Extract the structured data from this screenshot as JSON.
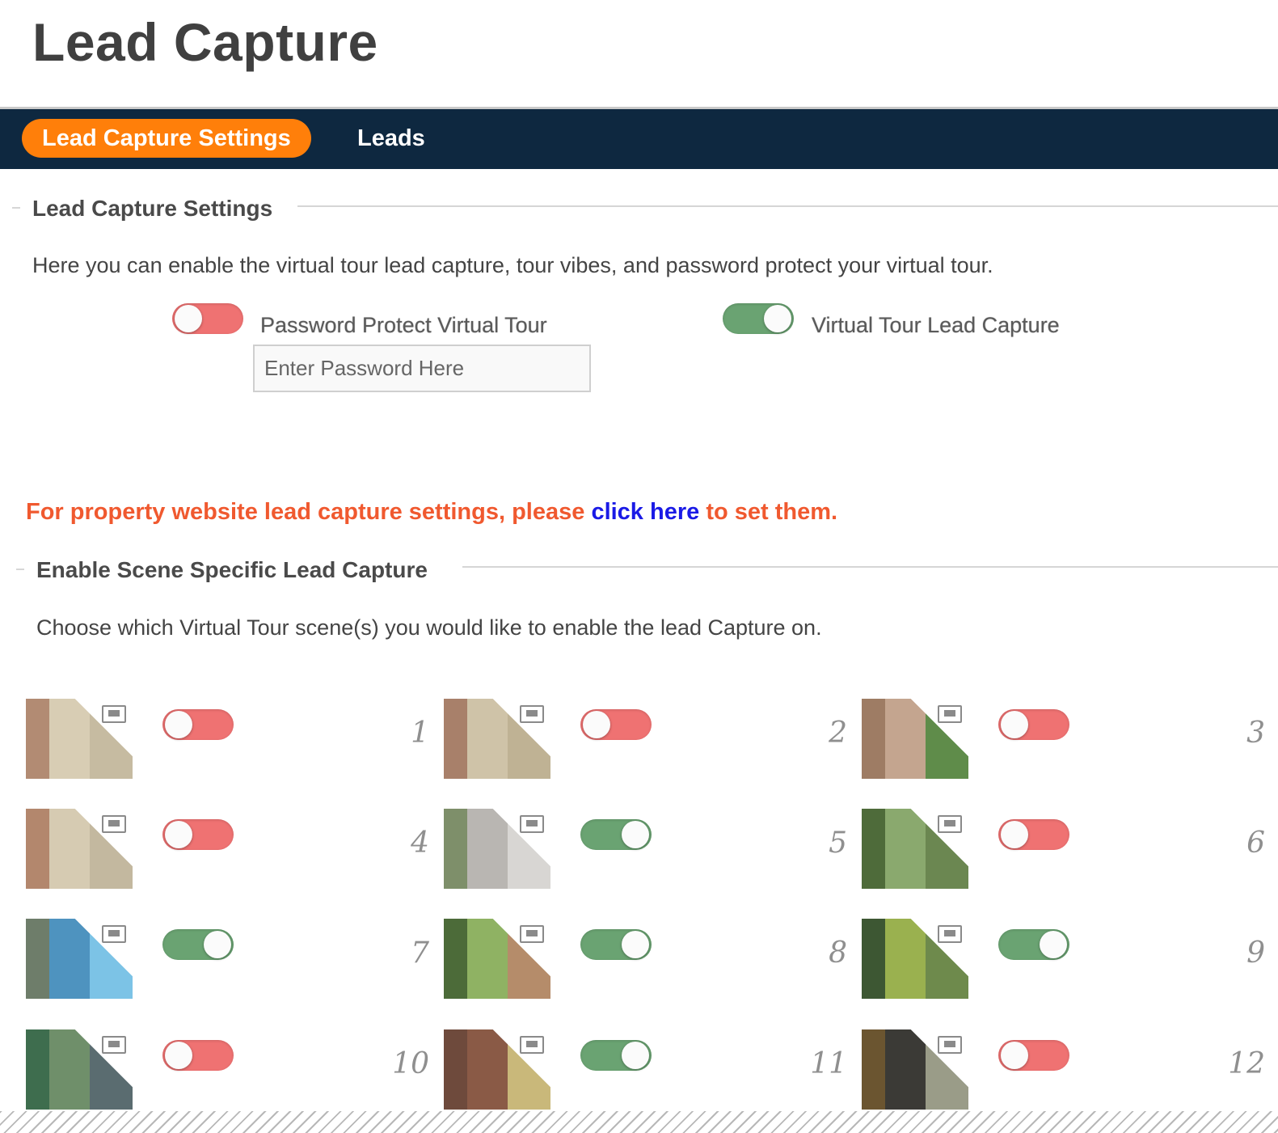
{
  "page": {
    "title": "Lead Capture"
  },
  "nav": {
    "tabs": [
      {
        "label": "Lead Capture Settings",
        "active": true
      },
      {
        "label": "Leads",
        "active": false
      }
    ]
  },
  "settings": {
    "legend": "Lead Capture Settings",
    "description": "Here you can enable the virtual tour lead capture, tour vibes, and password protect your virtual tour.",
    "password_toggle": {
      "label": "Password Protect Virtual Tour",
      "on": false
    },
    "password_input": {
      "placeholder": "Enter Password Here",
      "value": ""
    },
    "lead_capture_toggle": {
      "label": "Virtual Tour Lead Capture",
      "on": true
    }
  },
  "notice": {
    "prefix": "For property website lead capture settings, please ",
    "link": "click here",
    "suffix": " to set them."
  },
  "scenes_section": {
    "legend": "Enable Scene Specific Lead Capture",
    "description": "Choose which Virtual Tour scene(s) you would like to enable the lead Capture on.",
    "icon": "image-icon",
    "scenes": [
      {
        "num": "1",
        "on": false,
        "colors": [
          "#b28b73",
          "#d8cdb4",
          "#c6bba1"
        ]
      },
      {
        "num": "2",
        "on": false,
        "colors": [
          "#a8806a",
          "#cfc3a8",
          "#bfb294"
        ]
      },
      {
        "num": "3",
        "on": false,
        "colors": [
          "#9e7c64",
          "#c4a58f",
          "#5f8c4a"
        ]
      },
      {
        "num": "4",
        "on": false,
        "colors": [
          "#b3876d",
          "#d6cbb2",
          "#c3b89f"
        ]
      },
      {
        "num": "5",
        "on": true,
        "colors": [
          "#7e8f6a",
          "#b9b6b2",
          "#d8d6d3"
        ]
      },
      {
        "num": "6",
        "on": false,
        "colors": [
          "#4e6b3a",
          "#8aa96e",
          "#6b8751"
        ]
      },
      {
        "num": "7",
        "on": true,
        "colors": [
          "#6e7d6a",
          "#4e93bf",
          "#7cc3e6"
        ]
      },
      {
        "num": "8",
        "on": true,
        "colors": [
          "#4c6b39",
          "#8fb263",
          "#b58c6a"
        ]
      },
      {
        "num": "9",
        "on": true,
        "colors": [
          "#3d5733",
          "#9ab14f",
          "#6e8a4c"
        ]
      },
      {
        "num": "10",
        "on": false,
        "colors": [
          "#3e6d4e",
          "#6f8f6a",
          "#5a6c70"
        ]
      },
      {
        "num": "11",
        "on": true,
        "colors": [
          "#6e4a3c",
          "#8a5a46",
          "#c9b87a"
        ]
      },
      {
        "num": "12",
        "on": false,
        "colors": [
          "#6b5530",
          "#3b3a36",
          "#9a9c88"
        ]
      }
    ]
  }
}
